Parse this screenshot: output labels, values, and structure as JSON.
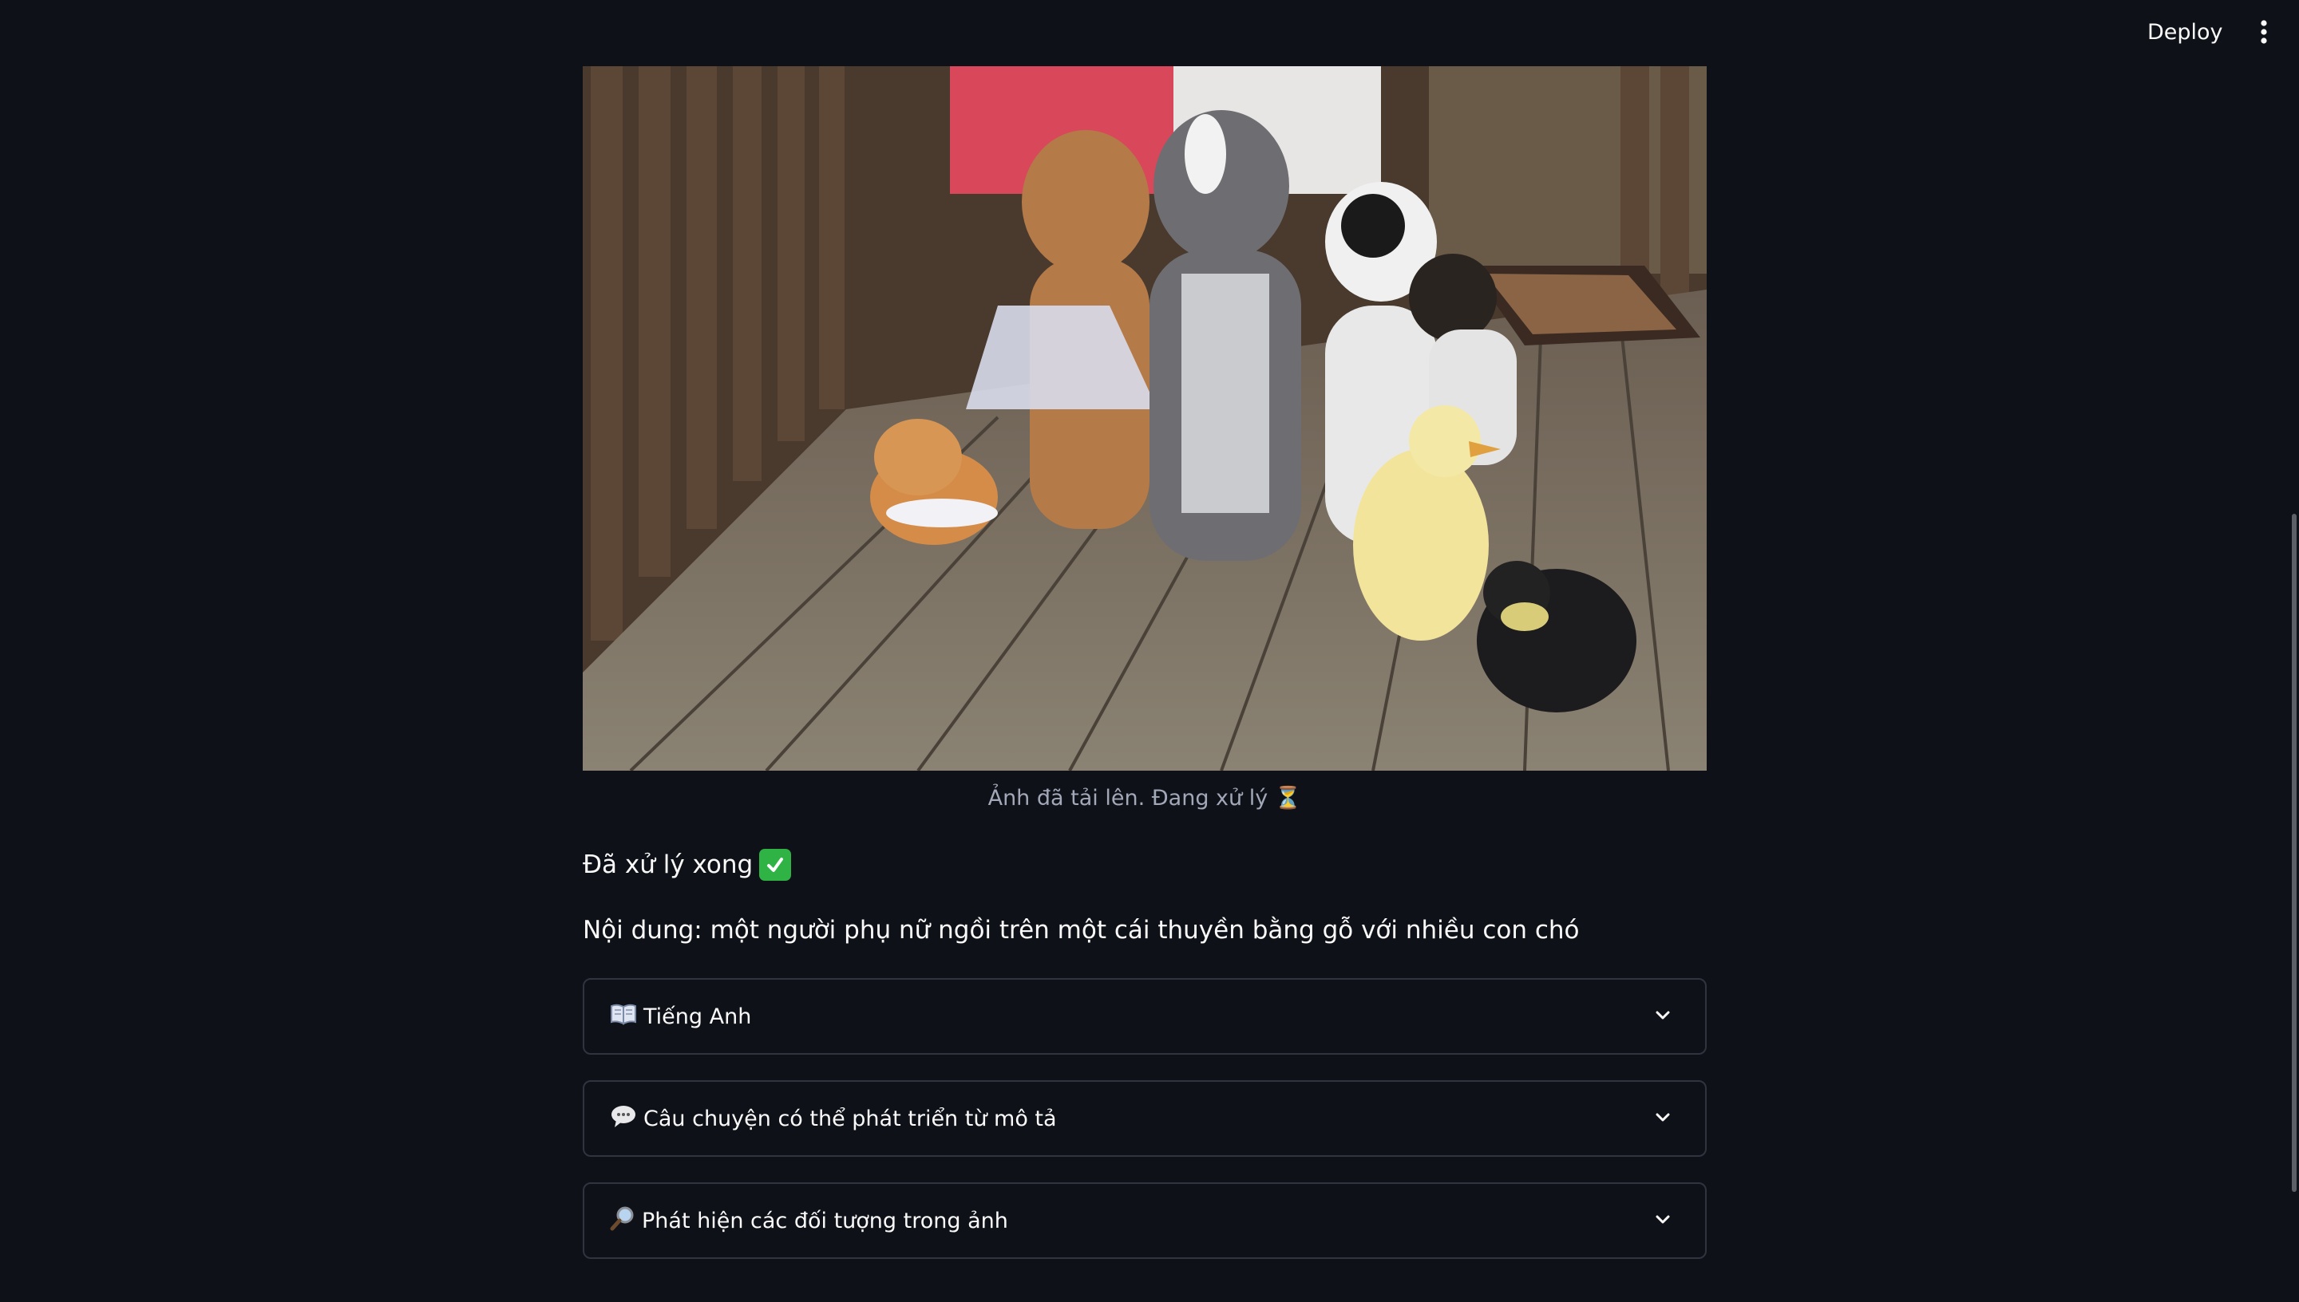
{
  "header": {
    "deploy_label": "Deploy",
    "menu_icon": "more-vertical-icon"
  },
  "image": {
    "caption": "Ảnh đã tải lên. Đang xử lý ⏳"
  },
  "status": {
    "text": "Đã xử lý xong",
    "icon": "check-mark-icon"
  },
  "content": {
    "text": "Nội dung: một người phụ nữ ngồi trên một cái thuyền bằng gỗ với nhiều con chó"
  },
  "expanders": [
    {
      "icon": "open-book-icon",
      "label": "Tiếng Anh"
    },
    {
      "icon": "speech-bubble-icon",
      "label": "Câu chuyện có thể phát triển từ mô tả"
    },
    {
      "icon": "magnifying-glass-icon",
      "label": "Phát hiện các đối tượng trong ảnh"
    }
  ],
  "colors": {
    "background": "#0e1117",
    "text": "#fafafa",
    "caption": "#a3a8b8",
    "border": "#31333f",
    "success": "#2fb344"
  }
}
